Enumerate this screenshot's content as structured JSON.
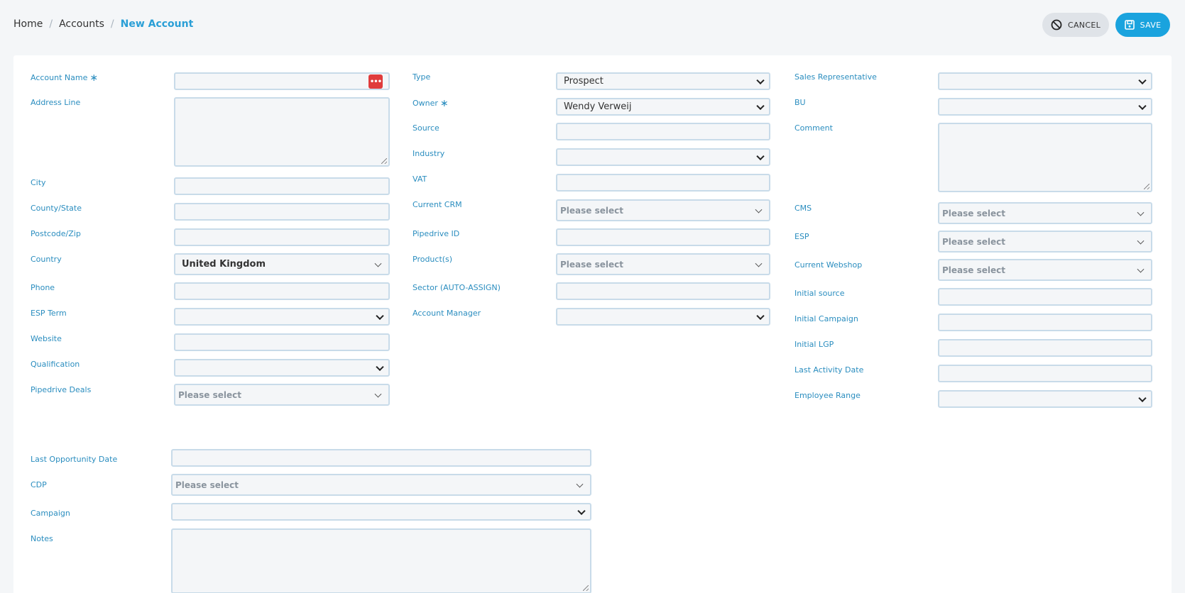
{
  "breadcrumb": {
    "home": "Home",
    "sep": "/",
    "accounts": "Accounts",
    "current": "New Account"
  },
  "actions": {
    "cancel": "CANCEL",
    "save": "SAVE"
  },
  "form": {
    "account_name": {
      "label": "Account Name",
      "required": "∗",
      "value": ""
    },
    "address_line": {
      "label": "Address Line",
      "value": ""
    },
    "city": {
      "label": "City",
      "value": ""
    },
    "county_state": {
      "label": "County/State",
      "value": ""
    },
    "postcode_zip": {
      "label": "Postcode/Zip",
      "value": ""
    },
    "country": {
      "label": "Country",
      "value": "United Kingdom"
    },
    "phone": {
      "label": "Phone",
      "value": ""
    },
    "esp_term": {
      "label": "ESP Term",
      "value": ""
    },
    "website": {
      "label": "Website",
      "value": ""
    },
    "qualification": {
      "label": "Qualification",
      "value": ""
    },
    "pipedrive_deals": {
      "label": "Pipedrive Deals",
      "placeholder": "Please select"
    },
    "type": {
      "label": "Type",
      "value": "Prospect"
    },
    "owner": {
      "label": "Owner",
      "required": "∗",
      "value": "Wendy Verweij"
    },
    "source": {
      "label": "Source",
      "value": ""
    },
    "industry": {
      "label": "Industry",
      "value": ""
    },
    "vat": {
      "label": "VAT",
      "value": ""
    },
    "current_crm": {
      "label": "Current CRM",
      "placeholder": "Please select"
    },
    "pipedrive_id": {
      "label": "Pipedrive ID",
      "value": ""
    },
    "products": {
      "label": "Product(s)",
      "placeholder": "Please select"
    },
    "sector": {
      "label": "Sector (AUTO-ASSIGN)",
      "value": ""
    },
    "account_manager": {
      "label": "Account Manager",
      "value": ""
    },
    "sales_rep": {
      "label": "Sales Representative",
      "value": ""
    },
    "bu": {
      "label": "BU",
      "value": ""
    },
    "comment": {
      "label": "Comment",
      "value": ""
    },
    "cms": {
      "label": "CMS",
      "placeholder": "Please select"
    },
    "esp": {
      "label": "ESP",
      "placeholder": "Please select"
    },
    "current_webshop": {
      "label": "Current Webshop",
      "placeholder": "Please select"
    },
    "initial_source": {
      "label": "Initial source",
      "value": ""
    },
    "initial_campaign": {
      "label": "Initial Campaign",
      "value": ""
    },
    "initial_lgp": {
      "label": "Initial LGP",
      "value": ""
    },
    "last_activity_date": {
      "label": "Last Activity Date",
      "value": ""
    },
    "employee_range": {
      "label": "Employee Range",
      "value": ""
    },
    "last_opportunity_date": {
      "label": "Last Opportunity Date",
      "value": ""
    },
    "cdp": {
      "label": "CDP",
      "placeholder": "Please select"
    },
    "campaign": {
      "label": "Campaign",
      "value": ""
    },
    "notes": {
      "label": "Notes",
      "value": ""
    }
  }
}
